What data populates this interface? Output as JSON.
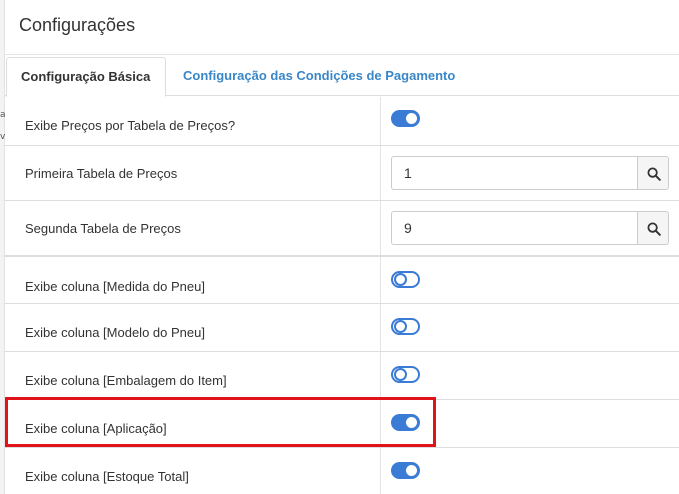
{
  "modal": {
    "title": "Configurações"
  },
  "tabs": [
    {
      "label": "Configuração Básica",
      "active": true
    },
    {
      "label": "Configuração das Condições de Pagamento",
      "active": false
    }
  ],
  "settings": [
    {
      "label": "Exibe Preços por Tabela de Preços?",
      "type": "toggle",
      "checked": true
    },
    {
      "label": "Primeira Tabela de Preços",
      "type": "lookup",
      "value": "1"
    },
    {
      "label": "Segunda Tabela de Preços",
      "type": "lookup",
      "value": "9"
    },
    {
      "label": "Exibe coluna [Medida do Pneu]",
      "type": "toggle",
      "checked": false
    },
    {
      "label": "Exibe coluna [Modelo do Pneu]",
      "type": "toggle",
      "checked": false
    },
    {
      "label": "Exibe coluna [Embalagem do Item]",
      "type": "toggle",
      "checked": false
    },
    {
      "label": "Exibe coluna [Aplicação]",
      "type": "toggle",
      "checked": true,
      "highlighted": true
    },
    {
      "label": "Exibe coluna [Estoque Total]",
      "type": "toggle",
      "checked": true
    }
  ],
  "icons": {
    "search": "search-icon"
  },
  "colors": {
    "accent": "#3a7bd5",
    "tab_link": "#3a87c8",
    "highlight": "#e0131a"
  },
  "left_edge_fragments": [
    "a",
    "v"
  ]
}
